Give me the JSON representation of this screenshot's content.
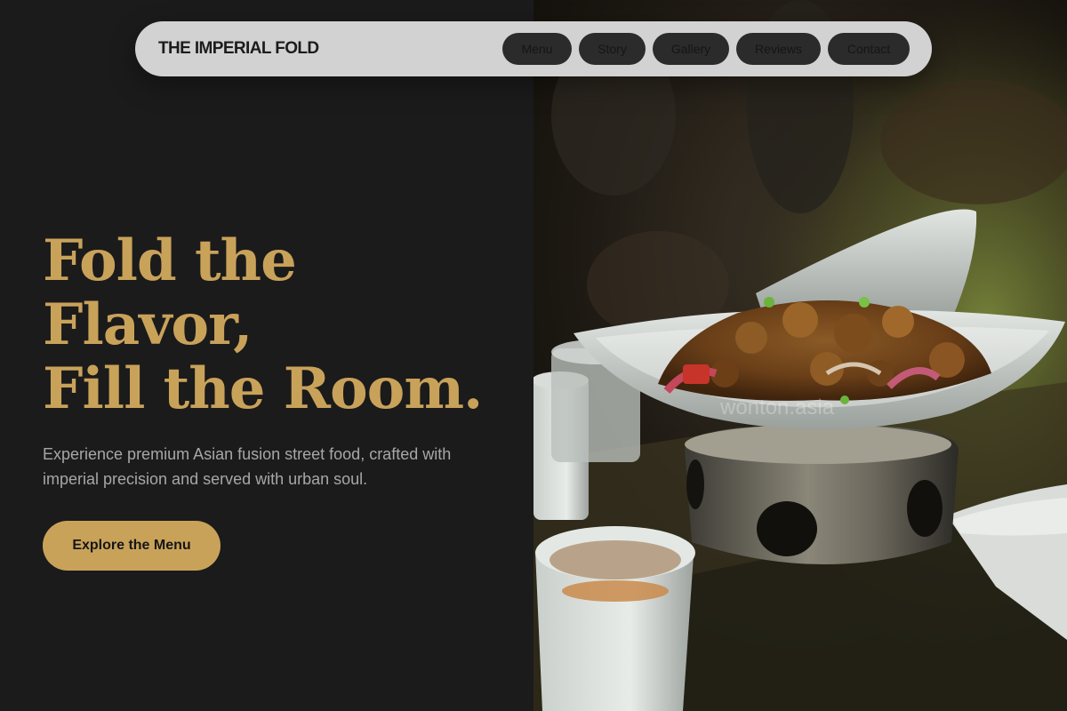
{
  "brand": {
    "name": "THE IMPERIAL FOLD"
  },
  "nav": {
    "items": [
      {
        "label": "Menu"
      },
      {
        "label": "Story"
      },
      {
        "label": "Gallery"
      },
      {
        "label": "Reviews"
      },
      {
        "label": "Contact"
      }
    ]
  },
  "hero": {
    "title_lines": [
      "Fold the",
      "Flavor,",
      "Fill the Room."
    ],
    "subtitle": "Experience premium Asian fusion street food, crafted with imperial precision and served with urban soul.",
    "cta_label": "Explore the Menu",
    "photo": {
      "watermark": "wonton.asia"
    }
  },
  "colors": {
    "background": "#1b1b1b",
    "accent_gold": "#c9a25a",
    "nav_bg": "#d2d2d2",
    "nav_pill": "#2b2b2b",
    "subtitle_text": "#a7a7a7"
  }
}
